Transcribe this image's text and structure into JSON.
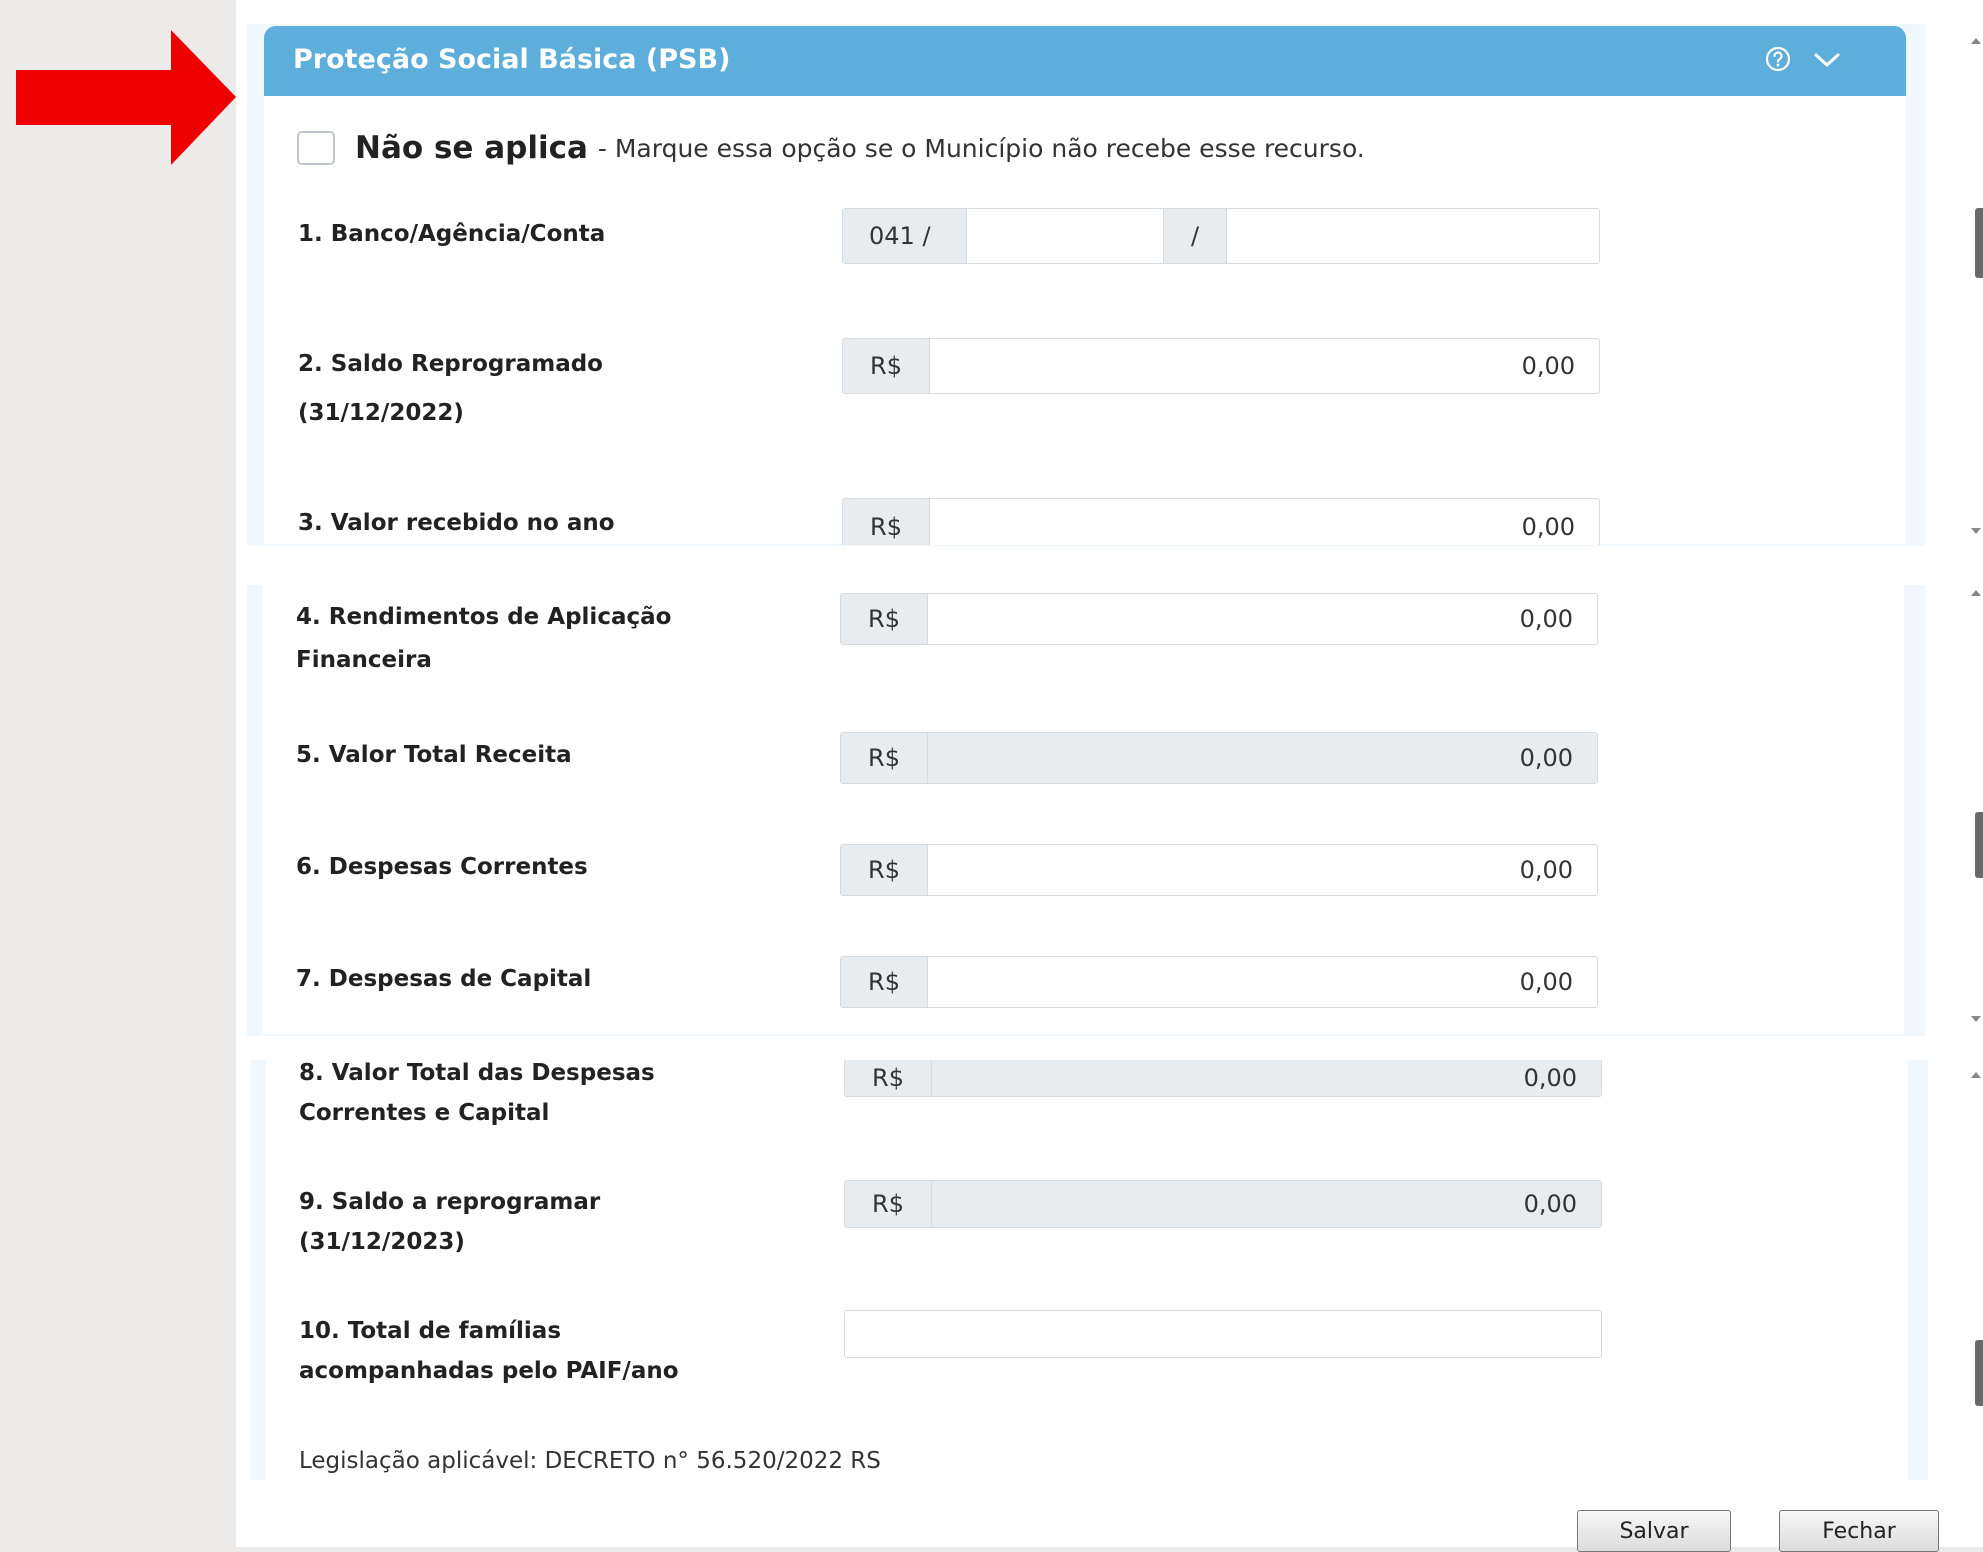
{
  "panel": {
    "title": "Proteção Social Básica (PSB)",
    "not_applicable": {
      "label": "Não se aplica",
      "description": "- Marque essa opção se o Município não recebe esse recurso."
    }
  },
  "fields": {
    "f1": {
      "label": "1. Banco/Agência/Conta",
      "bank": "041 /",
      "separator": "/",
      "agency": "",
      "account": ""
    },
    "f2": {
      "label_line1": "2. Saldo Reprogramado",
      "label_line2": "(31/12/2022)",
      "prefix": "R$",
      "value": "0,00"
    },
    "f3": {
      "label": "3. Valor recebido no ano",
      "prefix": "R$",
      "value": "0,00"
    },
    "f4": {
      "label_line1": "4. Rendimentos de Aplicação",
      "label_line2": "Financeira",
      "prefix": "R$",
      "value": "0,00"
    },
    "f5": {
      "label": "5. Valor Total Receita",
      "prefix": "R$",
      "value": "0,00"
    },
    "f6": {
      "label": "6. Despesas Correntes",
      "prefix": "R$",
      "value": "0,00"
    },
    "f7": {
      "label": "7. Despesas de Capital",
      "prefix": "R$",
      "value": "0,00"
    },
    "f8": {
      "label_line1": "8. Valor Total das Despesas",
      "label_line2": "Correntes e Capital",
      "prefix": "R$",
      "value": "0,00"
    },
    "f9": {
      "label_line1": "9. Saldo a reprogramar",
      "label_line2": "(31/12/2023)",
      "prefix": "R$",
      "value": "0,00"
    },
    "f10": {
      "label_line1": "10. Total de famílias",
      "label_line2": "acompanhadas pelo PAIF/ano",
      "value": ""
    }
  },
  "legislation": "Legislação aplicável: DECRETO n° 56.520/2022 RS",
  "buttons": {
    "save": "Salvar",
    "close": "Fechar"
  },
  "colors": {
    "header": "#5eaedb",
    "arrow": "#ee0000",
    "readonly_fill": "#e9ecef"
  },
  "icons": {
    "arrow": "red-arrow-icon",
    "help": "help-circle-icon",
    "collapse": "chevron-down-icon"
  }
}
